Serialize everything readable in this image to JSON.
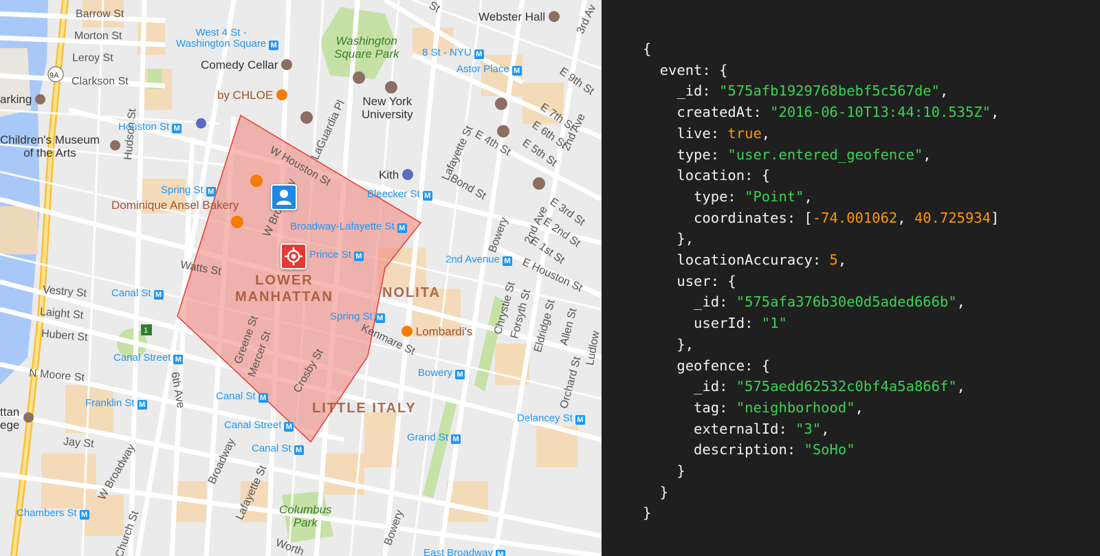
{
  "map": {
    "labels": {
      "barrow": "Barrow St",
      "morton": "Morton St",
      "leroy": "Leroy St",
      "clarkson": "Clarkson St",
      "route9a": "9A",
      "parking": "arking",
      "childrens_museum": "Children's Museum\nof the Arts",
      "hudson": "Hudson St",
      "vestry": "Vestry St",
      "laight": "Laight St",
      "hubert": "Hubert St",
      "n_moore": "N Moore St",
      "college": "ttan\nege",
      "jay": "Jay St",
      "w_broadway": "W Broadway",
      "church": "Church St",
      "sixth_ave": "6th Ave",
      "watts": "Watts St",
      "broadway": "Broadway",
      "lafayette_lower": "Lafayette St",
      "worth": "Worth",
      "greene": "Greene St",
      "mercer": "Mercer St",
      "crosby": "Crosby St",
      "kenmare": "Kenmare St",
      "w_houston": "W Houston St",
      "w_broadway_upper": "W Broadway",
      "laguardia": "LaGuardia Pl",
      "lafayette_upper": "Lafayette St",
      "e4th": "E 4th St",
      "bond": "Bond St",
      "bowery_upper": "Bowery",
      "bowery_lower": "Bowery",
      "e9th": "E 9th St",
      "e7th": "E 7th St",
      "e6th": "E 6th St",
      "e5th": "E 5th St",
      "e3rd": "E 3rd St",
      "e2nd": "E 2nd St",
      "e1st": "E 1st St",
      "e_houston": "E Houston St",
      "second_ave_a": "2nd Ave",
      "second_ave_b": "2nd Ave",
      "third_ave": "3rd Av",
      "chrystie": "Chrystie St",
      "forsyth": "Forsyth St",
      "eldridge": "Eldridge St",
      "allen": "Allen St",
      "orchard": "Orchard St",
      "ludlow": "Ludlow",
      "st_top": "St",
      "route1": "1"
    },
    "poi": {
      "webster_hall": "Webster Hall",
      "comedy_cellar": "Comedy Cellar",
      "by_chloe": "by CHLOE",
      "nyu": "New York\nUniversity",
      "kith": "Kith",
      "dominique": "Dominique Ansel Bakery",
      "lombardis": "Lombardi's"
    },
    "parks": {
      "washington_square": "Washington\nSquare Park",
      "columbus": "Columbus\nPark"
    },
    "neighborhoods": {
      "lower_manhattan": "LOWER\nMANHATTAN",
      "nolita": "NOLITA",
      "little_italy": "LITTLE ITALY"
    },
    "transit": {
      "west4": "West 4 St -\nWashington Square",
      "eight_st": "8 St - NYU",
      "astor": "Astor Place",
      "houston": "Houston St",
      "spring_w": "Spring St",
      "bleecker": "Bleecker St",
      "broadway_lafayette": "Broadway-Lafayette St",
      "prince": "Prince St",
      "second_avenue": "2nd Avenue",
      "canal_w": "Canal St",
      "spring_e": "Spring St",
      "canal_street_w": "Canal Street",
      "bowery": "Bowery",
      "franklin": "Franklin St",
      "canal_mid": "Canal St",
      "canal_street_mid": "Canal Street",
      "canal_low": "Canal St",
      "grand": "Grand St",
      "delancey": "Delancey St",
      "chambers": "Chambers St",
      "east_broadway": "East Broadway"
    },
    "colors": {
      "geofence_fill": "#f28b82",
      "geofence_stroke": "#e53935",
      "user_marker": "#1e88e5",
      "target_marker": "#e53935"
    },
    "icons": [
      "user-icon",
      "target-icon",
      "metro-icon",
      "restaurant-icon",
      "university-icon",
      "parking-icon",
      "museum-icon",
      "shopping-icon"
    ]
  },
  "code": {
    "lines": [
      [
        {
          "t": "p",
          "v": "{"
        }
      ],
      [
        {
          "t": "p",
          "v": "  event: {"
        }
      ],
      [
        {
          "t": "p",
          "v": "    _id: "
        },
        {
          "t": "s",
          "v": "\"575afb1929768bebf5c567de\""
        },
        {
          "t": "p",
          "v": ","
        }
      ],
      [
        {
          "t": "p",
          "v": "    createdAt: "
        },
        {
          "t": "s",
          "v": "\"2016-06-10T13:44:10.535Z\""
        },
        {
          "t": "p",
          "v": ","
        }
      ],
      [
        {
          "t": "p",
          "v": "    live: "
        },
        {
          "t": "n",
          "v": "true"
        },
        {
          "t": "p",
          "v": ","
        }
      ],
      [
        {
          "t": "p",
          "v": "    type: "
        },
        {
          "t": "s",
          "v": "\"user.entered_geofence\""
        },
        {
          "t": "p",
          "v": ","
        }
      ],
      [
        {
          "t": "p",
          "v": "    location: {"
        }
      ],
      [
        {
          "t": "p",
          "v": "      type: "
        },
        {
          "t": "s",
          "v": "\"Point\""
        },
        {
          "t": "p",
          "v": ","
        }
      ],
      [
        {
          "t": "p",
          "v": "      coordinates: ["
        },
        {
          "t": "n",
          "v": "-74.001062"
        },
        {
          "t": "p",
          "v": ", "
        },
        {
          "t": "n",
          "v": "40.725934"
        },
        {
          "t": "p",
          "v": "]"
        }
      ],
      [
        {
          "t": "p",
          "v": "    },"
        }
      ],
      [
        {
          "t": "p",
          "v": "    locationAccuracy: "
        },
        {
          "t": "n",
          "v": "5"
        },
        {
          "t": "p",
          "v": ","
        }
      ],
      [
        {
          "t": "p",
          "v": "    user: {"
        }
      ],
      [
        {
          "t": "p",
          "v": "      _id: "
        },
        {
          "t": "s",
          "v": "\"575afa376b30e0d5aded666b\""
        },
        {
          "t": "p",
          "v": ","
        }
      ],
      [
        {
          "t": "p",
          "v": "      userId: "
        },
        {
          "t": "s",
          "v": "\"1\""
        }
      ],
      [
        {
          "t": "p",
          "v": "    },"
        }
      ],
      [
        {
          "t": "p",
          "v": "    geofence: {"
        }
      ],
      [
        {
          "t": "p",
          "v": "      _id: "
        },
        {
          "t": "s",
          "v": "\"575aedd62532c0bf4a5a866f\""
        },
        {
          "t": "p",
          "v": ","
        }
      ],
      [
        {
          "t": "p",
          "v": "      tag: "
        },
        {
          "t": "s",
          "v": "\"neighborhood\""
        },
        {
          "t": "p",
          "v": ","
        }
      ],
      [
        {
          "t": "p",
          "v": "      externalId: "
        },
        {
          "t": "s",
          "v": "\"3\""
        },
        {
          "t": "p",
          "v": ","
        }
      ],
      [
        {
          "t": "p",
          "v": "      description: "
        },
        {
          "t": "s",
          "v": "\"SoHo\""
        }
      ],
      [
        {
          "t": "p",
          "v": "    }"
        }
      ],
      [
        {
          "t": "p",
          "v": "  }"
        }
      ],
      [
        {
          "t": "p",
          "v": "}"
        }
      ]
    ],
    "colors": {
      "string": "#39d353",
      "number": "#ff9800",
      "punctuation": "#f2f2f2",
      "background": "#1f1f1f"
    }
  }
}
